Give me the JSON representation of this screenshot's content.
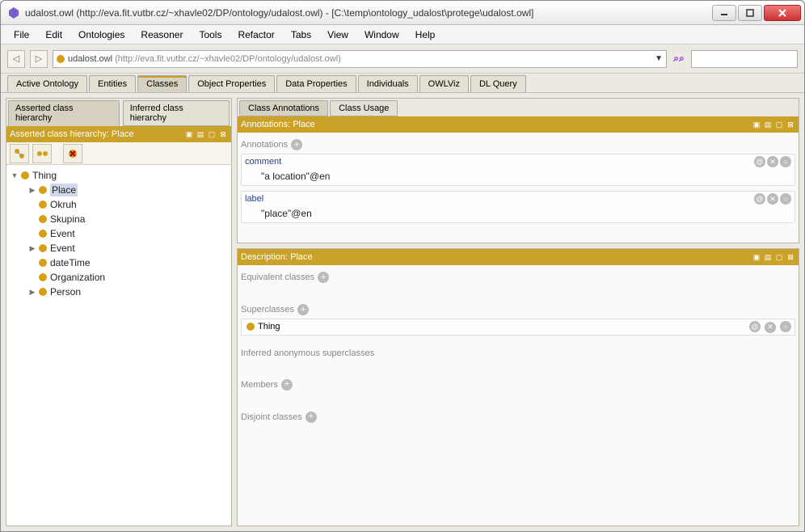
{
  "window": {
    "title": "udalost.owl (http://eva.fit.vutbr.cz/~xhavle02/DP/ontology/udalost.owl) - [C:\\temp\\ontology_udalost\\protege\\udalost.owl]"
  },
  "menubar": {
    "items": [
      "File",
      "Edit",
      "Ontologies",
      "Reasoner",
      "Tools",
      "Refactor",
      "Tabs",
      "View",
      "Window",
      "Help"
    ]
  },
  "addressbar": {
    "ontology_label": "udalost.owl",
    "ontology_uri": "(http://eva.fit.vutbr.cz/~xhavle02/DP/ontology/udalost.owl)"
  },
  "tabs": {
    "items": [
      "Active Ontology",
      "Entities",
      "Classes",
      "Object Properties",
      "Data Properties",
      "Individuals",
      "OWLViz",
      "DL Query"
    ],
    "active_index": 2
  },
  "hierarchy_tabs": {
    "asserted": "Asserted class hierarchy",
    "inferred": "Inferred class hierarchy"
  },
  "hierarchy_panel": {
    "title": "Asserted class hierarchy: Place"
  },
  "tree": {
    "root": "Thing",
    "children": [
      "Place",
      "Okruh",
      "Skupina",
      "Event",
      "Event",
      "dateTime",
      "Organization",
      "Person"
    ],
    "selected": "Place",
    "expandable_children_idx": [
      0,
      4,
      7
    ]
  },
  "right_tabs": {
    "annotations": "Class Annotations",
    "usage": "Class Usage"
  },
  "annotations_panel": {
    "title": "Annotations: Place",
    "section_label": "Annotations",
    "entries": [
      {
        "key": "comment",
        "value": "\"a location\"@en"
      },
      {
        "key": "label",
        "value": "\"place\"@en"
      }
    ]
  },
  "description_panel": {
    "title": "Description: Place",
    "equivalent_label": "Equivalent classes",
    "superclasses_label": "Superclasses",
    "superclass_value": "Thing",
    "inferred_label": "Inferred anonymous superclasses",
    "members_label": "Members",
    "disjoint_label": "Disjoint classes"
  }
}
